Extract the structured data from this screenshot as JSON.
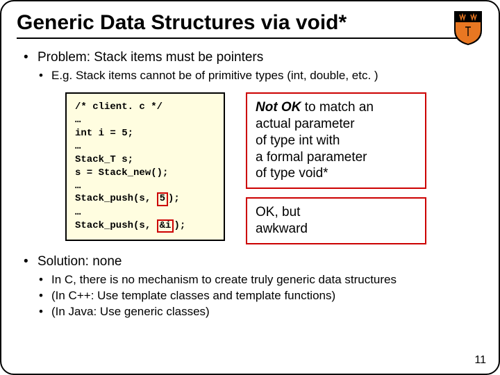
{
  "title": "Generic Data Structures via void*",
  "problem": {
    "heading": "Problem: Stack items must be pointers",
    "sub": "E.g. Stack items cannot be of primitive types (int, double, etc. )"
  },
  "code": {
    "l1": "/* client. c */",
    "l2": "…",
    "l3": "int i = 5;",
    "l4": "…",
    "l5": "Stack_T s;",
    "l6": "s = Stack_new();",
    "l7": "…",
    "l8a": "Stack_push(s, ",
    "l8hi": "5",
    "l8b": ");",
    "l9": "…",
    "l10a": "Stack_push(s, ",
    "l10hi": "&i",
    "l10b": ");"
  },
  "note1": {
    "em": "Not OK",
    "rest1": " to match an",
    "rest2": "actual parameter",
    "rest3": "of type int with",
    "rest4": "a formal parameter",
    "rest5": "of type void*"
  },
  "note2": {
    "l1": "OK, but",
    "l2": "awkward"
  },
  "solution": {
    "heading": "Solution: none",
    "s1": "In C, there is no mechanism to create truly generic data structures",
    "s2": "(In C++: Use template classes and template functions)",
    "s3": "(In Java: Use generic classes)"
  },
  "page": "11"
}
